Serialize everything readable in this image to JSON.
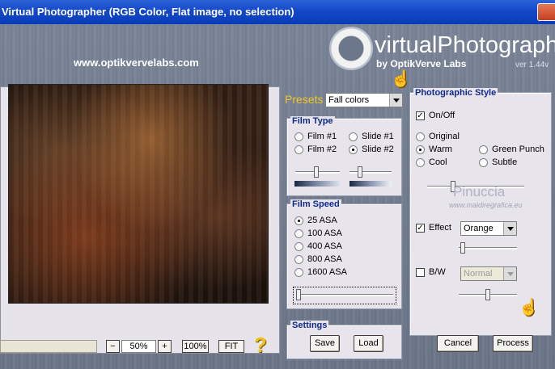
{
  "window": {
    "title": "Virtual Photographer (RGB Color, Flat image, no selection)"
  },
  "header": {
    "url": "www.optikvervelabs.com",
    "logo_title": "virtualPhotographer",
    "logo_sub": "by OptikVerve Labs",
    "version": "ver 1.44v"
  },
  "zoom": {
    "minus": "−",
    "value": "50%",
    "plus": "+",
    "btn_100": "100%",
    "btn_fit": "FIT",
    "help": "?"
  },
  "presets": {
    "label": "Presets",
    "selected": "Fall colors"
  },
  "film_type": {
    "title": "Film Type",
    "options": [
      "Film #1",
      "Slide #1",
      "Film #2",
      "Slide #2"
    ],
    "selected": "Slide #2",
    "slider1_level": 0.45,
    "slider2_level": 0.25
  },
  "film_speed": {
    "title": "Film Speed",
    "options": [
      "25 ASA",
      "100 ASA",
      "400 ASA",
      "800 ASA",
      "1600 ASA"
    ],
    "selected": "25 ASA",
    "slider_level": 0.0
  },
  "settings": {
    "title": "Settings",
    "save": "Save",
    "load": "Load"
  },
  "photographic_style": {
    "title": "Photographic Style",
    "onoff_label": "On/Off",
    "onoff_checked": true,
    "styles": [
      "Original",
      "Warm",
      "Green Punch",
      "Cool",
      "Subtle"
    ],
    "selected": "Warm",
    "style_slider_level": 0.3,
    "effect_label": "Effect",
    "effect_checked": true,
    "effect_value": "Orange",
    "effect_slider_level": 0.05,
    "bw_label": "B/W",
    "bw_checked": false,
    "bw_value": "Normal",
    "bw_slider_level": 0.5
  },
  "watermark": {
    "big": "Pinuccia",
    "small": "www.maidiregrafica.eu"
  },
  "footer": {
    "cancel": "Cancel",
    "process": "Process"
  }
}
